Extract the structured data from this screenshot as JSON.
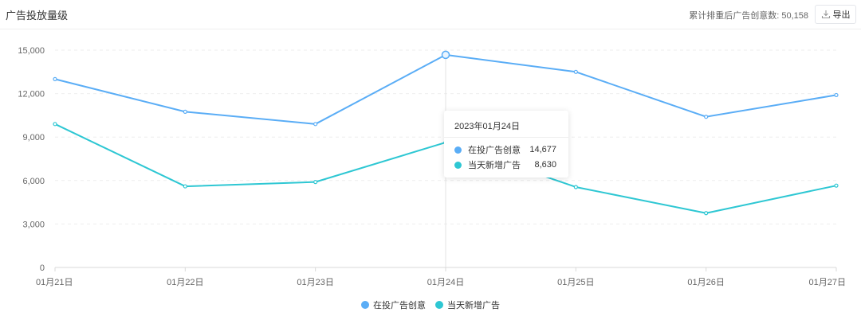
{
  "header": {
    "title": "广告投放量级",
    "summary_label": "累计排重后广告创意数:",
    "summary_value": "50,158",
    "export_label": "导出",
    "export_icon": "download-icon"
  },
  "colors": {
    "series_1": "#5aadf6",
    "series_2": "#2ec7d3",
    "grid": "#eeeeee",
    "axis": "#d9d9d9",
    "tick_text": "#666666"
  },
  "tooltip": {
    "title": "2023年01月24日",
    "rows": [
      {
        "name": "在投广告创意",
        "value": "14,677"
      },
      {
        "name": "当天新增广告",
        "value": "8,630"
      }
    ]
  },
  "chart_data": {
    "type": "line",
    "title": "广告投放量级",
    "x": [
      "01月21日",
      "01月22日",
      "01月23日",
      "01月24日",
      "01月25日",
      "01月26日",
      "01月27日"
    ],
    "ylim": [
      0,
      15000
    ],
    "yticks": [
      "0",
      "3,000",
      "6,000",
      "9,000",
      "12,000",
      "15,000"
    ],
    "ytick_values": [
      0,
      3000,
      6000,
      9000,
      12000,
      15000
    ],
    "grid": true,
    "legend_position": "bottom",
    "highlight_index": 3,
    "series": [
      {
        "name": "在投广告创意",
        "values": [
          13000,
          10750,
          9900,
          14677,
          13500,
          10400,
          11900
        ]
      },
      {
        "name": "当天新增广告",
        "values": [
          9900,
          5600,
          5900,
          8630,
          5550,
          3750,
          5650
        ]
      }
    ]
  }
}
